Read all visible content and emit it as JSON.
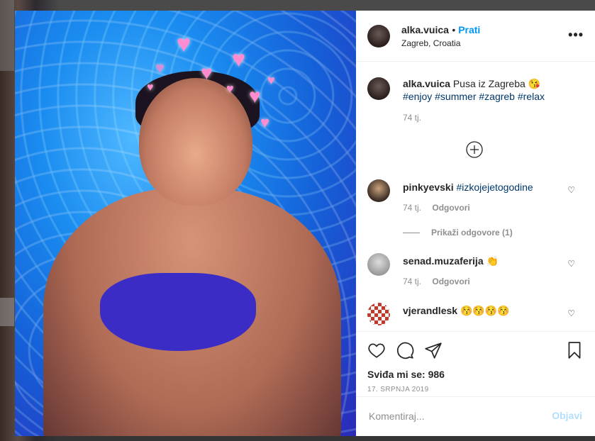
{
  "post": {
    "username": "alka.vuica",
    "follow_label": "Prati",
    "location": "Zagreb, Croatia",
    "more_label": "•••"
  },
  "caption": {
    "username": "alka.vuica",
    "text": "Pusa iz Zagreba 😘",
    "hashtags": "#enjoy #summer #zagreb #relax",
    "time": "74 tj."
  },
  "load_more_label": "⊕",
  "comments": [
    {
      "username": "pinkyevski",
      "text": "#izkojejetogodine",
      "time": "74 tj.",
      "reply_label": "Odgovori"
    },
    {
      "username": "senad.muzaferija",
      "text": "👏",
      "time": "74 tj.",
      "reply_label": "Odgovori"
    },
    {
      "username": "vjerandlesk",
      "text": "😚😚😚😚"
    }
  ],
  "show_replies_label": "Prikaži odgovore (1)",
  "likes": "Sviđa mi se: 986",
  "date": "17. SRPNJA 2019",
  "comment_box": {
    "placeholder": "Komentiraj...",
    "post_label": "Objavi"
  },
  "icons": {
    "like": "heart-icon",
    "comment": "comment-icon",
    "share": "send-icon",
    "save": "bookmark-icon"
  },
  "colors": {
    "accent": "#0095f6",
    "hashtag": "#00376b",
    "muted": "#8e8e8e",
    "post_disabled": "#b2dffc"
  }
}
